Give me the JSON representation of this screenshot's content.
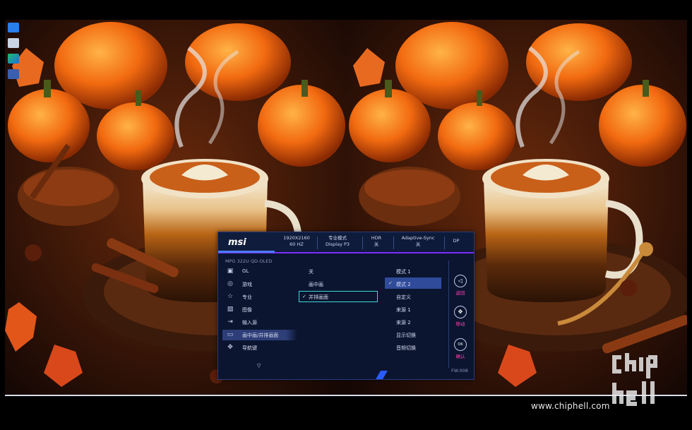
{
  "osd": {
    "logo": "msi",
    "resolution": [
      "1920X2160",
      "60 HZ"
    ],
    "mode": [
      "专业模式",
      "Display P3"
    ],
    "hdr": [
      "HDR",
      "关"
    ],
    "adaptive_sync": [
      "Adaptive-Sync",
      "关"
    ],
    "input": "DP",
    "model": "MPG 322U QD-OLED",
    "menu": [
      {
        "icon": "gl-icon",
        "glyph": "▣",
        "label": "GL"
      },
      {
        "icon": "gamepad-icon",
        "glyph": "◎",
        "label": "游戏"
      },
      {
        "icon": "star-icon",
        "glyph": "☆",
        "label": "专业"
      },
      {
        "icon": "image-icon",
        "glyph": "▨",
        "label": "图像"
      },
      {
        "icon": "input-source-icon",
        "glyph": "⇥",
        "label": "输入源"
      },
      {
        "icon": "pip-icon",
        "glyph": "▭",
        "label": "画中画/并排画面"
      },
      {
        "icon": "navigation-icon",
        "glyph": "✥",
        "label": "导航键"
      }
    ],
    "submenu": [
      "关",
      "画中画",
      "并排画面"
    ],
    "submenu_check": "✓",
    "options": [
      "模式 1",
      "模式 2",
      "自定义",
      "来源 1",
      "来源 2",
      "显示切换",
      "音频切换"
    ],
    "options_check": "✓",
    "down_arrow": "▽",
    "buttons": [
      {
        "icon": "back-icon",
        "glyph": "◁",
        "label": "返回"
      },
      {
        "icon": "move-icon",
        "glyph": "✥",
        "label": "移动"
      },
      {
        "icon": "ok-icon",
        "glyph": "OK",
        "label": "确认"
      }
    ],
    "firmware": "FW.008"
  },
  "watermark": "www.chiphell.com",
  "colors": {
    "osd_bg": "#0b1530",
    "accent_purple": "#7a2cff",
    "accent_pink": "#ff3fb0",
    "selection_blue": "#2f4b9a",
    "highlight_cyan": "#3fd7d7"
  }
}
